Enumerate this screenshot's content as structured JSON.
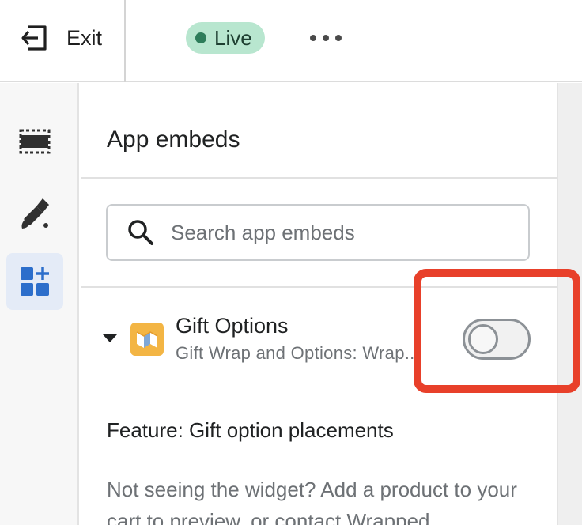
{
  "topbar": {
    "exit_label": "Exit",
    "status": {
      "label": "Live",
      "color": "#2e7d5a",
      "bg": "#b8e6cf"
    },
    "more_icon": "more-horizontal-icon"
  },
  "rail": {
    "items": [
      {
        "name": "sections",
        "icon": "layout-sections-icon",
        "active": false
      },
      {
        "name": "theme-settings",
        "icon": "paint-brush-icon",
        "active": false
      },
      {
        "name": "app-embeds",
        "icon": "apps-add-icon",
        "active": true
      }
    ]
  },
  "panel": {
    "title": "App embeds",
    "search": {
      "placeholder": "Search app embeds",
      "value": ""
    },
    "embeds": [
      {
        "name": "Gift Options",
        "description": "Gift Wrap and Options: Wrap...",
        "enabled": false,
        "expanded": true
      }
    ],
    "feature_title": "Feature: Gift option placements",
    "feature_text": "Not seeing the widget? Add a product to your cart to preview, or contact Wrapped"
  },
  "colors": {
    "highlight": "#e8402a",
    "accent": "#2c6ecb"
  }
}
